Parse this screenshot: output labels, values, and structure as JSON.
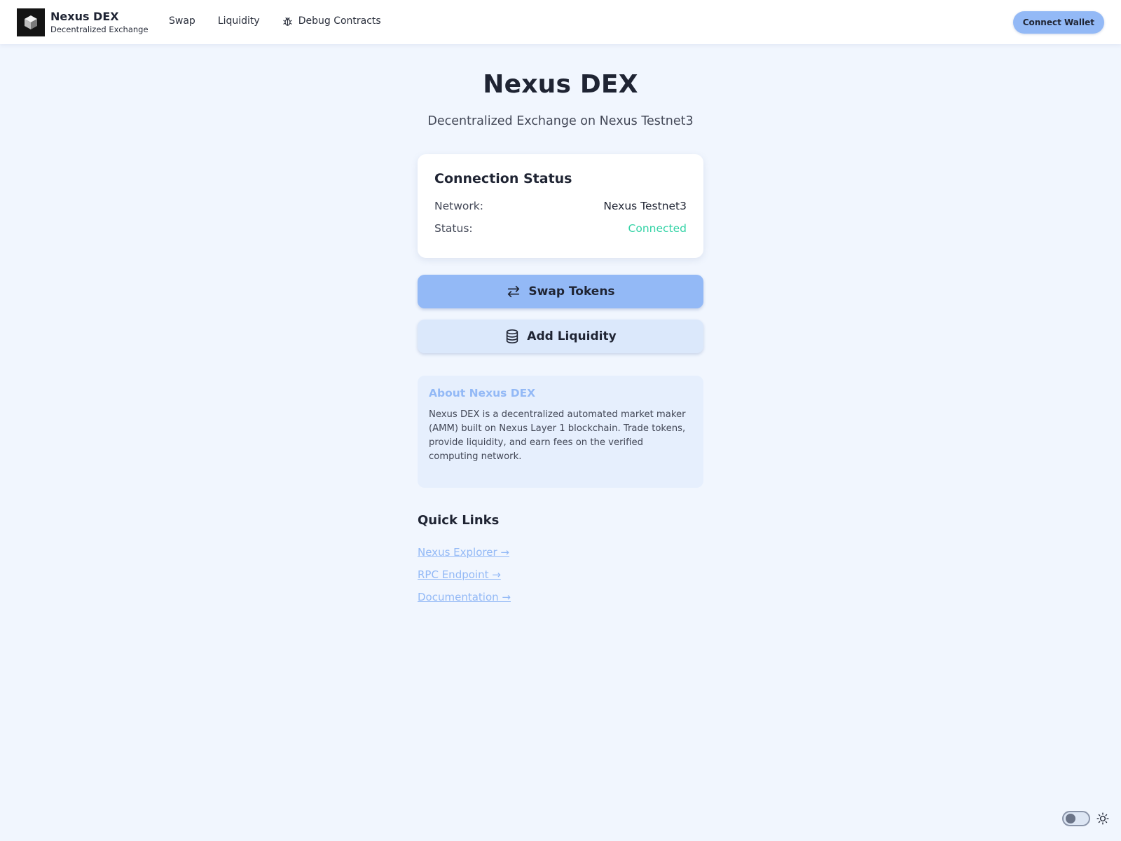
{
  "brand": {
    "title": "Nexus DEX",
    "subtitle": "Decentralized Exchange",
    "logo_icon": "cube-icon"
  },
  "nav": {
    "items": [
      {
        "label": "Swap"
      },
      {
        "label": "Liquidity"
      },
      {
        "label": "Debug Contracts",
        "icon": "bug-icon"
      }
    ]
  },
  "header": {
    "connect_label": "Connect Wallet"
  },
  "hero": {
    "title": "Nexus DEX",
    "subtitle": "Decentralized Exchange on Nexus Testnet3"
  },
  "connection": {
    "title": "Connection Status",
    "network_label": "Network:",
    "network_value": "Nexus Testnet3",
    "status_label": "Status:",
    "status_value": "Connected",
    "status_color": "#34d3a6"
  },
  "actions": {
    "swap_label": "Swap Tokens",
    "swap_icon": "arrows-swap-icon",
    "liquidity_label": "Add Liquidity",
    "liquidity_icon": "database-icon"
  },
  "about": {
    "title": "About Nexus DEX",
    "text": "Nexus DEX is a decentralized automated market maker (AMM) built on Nexus Layer 1 blockchain. Trade tokens, provide liquidity, and earn fees on the verified computing network."
  },
  "quick_links": {
    "title": "Quick Links",
    "items": [
      {
        "label": "Nexus Explorer →"
      },
      {
        "label": "RPC Endpoint →"
      },
      {
        "label": "Documentation →"
      }
    ]
  },
  "theme": {
    "mode": "light",
    "icon": "sun-icon"
  },
  "colors": {
    "accent": "#93b9f6",
    "background": "#f1f6fe",
    "success": "#34d3a6",
    "text": "#1f2433"
  }
}
